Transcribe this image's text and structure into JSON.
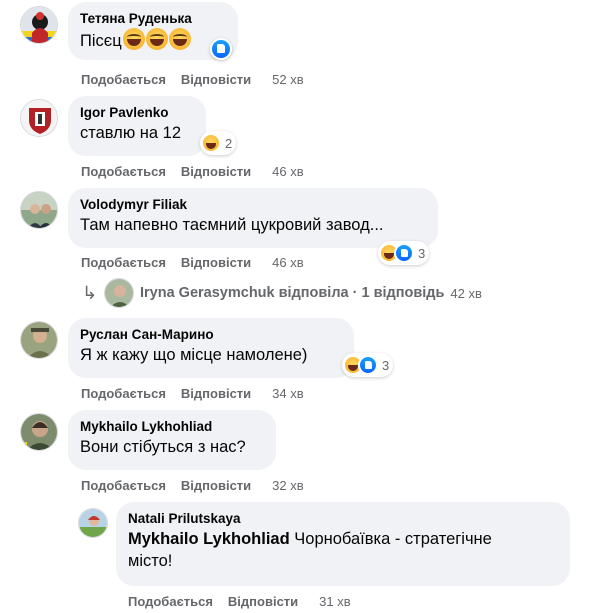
{
  "action_labels": {
    "like": "Подобається",
    "reply": "Відповісти"
  },
  "comments": [
    {
      "author": "Тетяна Руденька",
      "text": "Пісєц",
      "emoji_count": 3,
      "reaction": "like",
      "time": "52 хв"
    },
    {
      "author": "Igor Pavlenko",
      "text": "ставлю на 12",
      "reactions": "haha",
      "reaction_count": "2",
      "time": "46 хв"
    },
    {
      "author": "Volodymyr Filiak",
      "text": "Там напевно таємний цукровий завод...",
      "reactions": "haha, like",
      "reaction_count": "3",
      "time": "46 хв",
      "replies_summary": {
        "name": "Iryna Gerasymchuk",
        "text": "Iryna Gerasymchuk відповіла · 1 відповідь",
        "time": "42 хв"
      }
    },
    {
      "author": "Руслан Сан-Марино",
      "text": "Я ж кажу що місце намолене)",
      "reactions": "haha, like",
      "reaction_count": "3",
      "time": "34 хв"
    },
    {
      "author": "Mykhailo Lykhohliad",
      "text": "Вони стібуться з нас?",
      "time": "32 хв"
    }
  ],
  "reply": {
    "author": "Natali Prilutskaya",
    "mention": "Mykhailo Lykhohliad",
    "text_line1": "Чорнобаївка - стратегічне",
    "text_line2": "місто!",
    "time": "31 хв"
  }
}
